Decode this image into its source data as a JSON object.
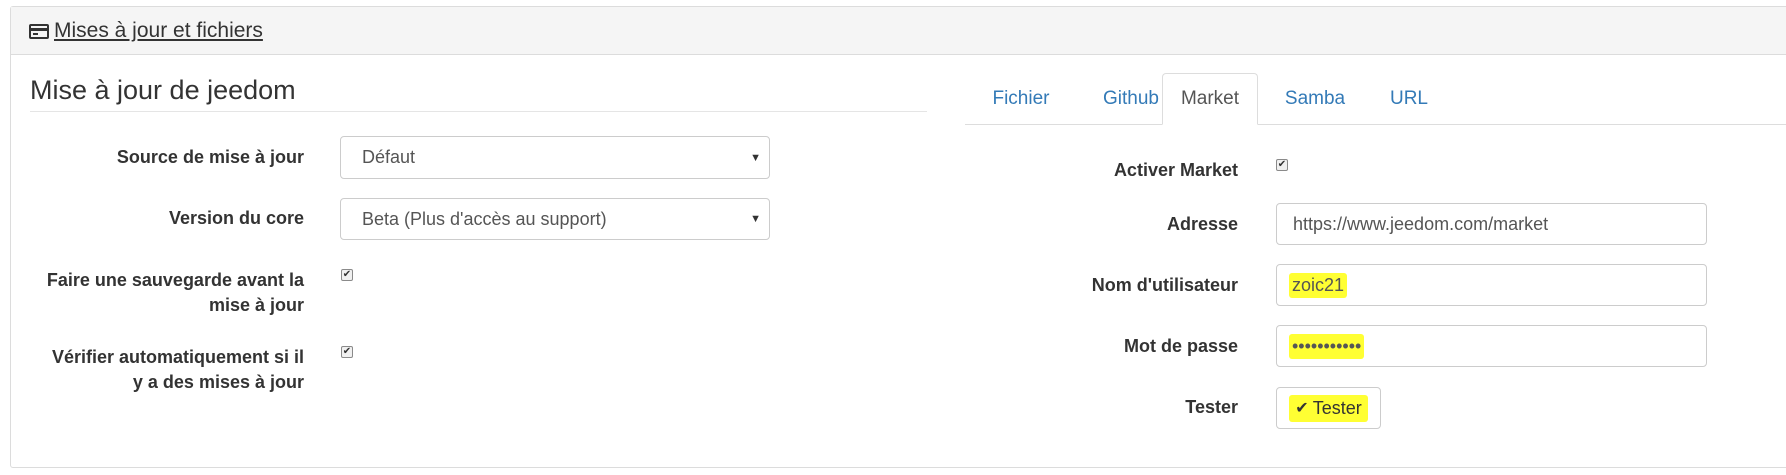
{
  "panel": {
    "title": "Mises à jour et fichiers",
    "icon": "credit-card-icon"
  },
  "update": {
    "title": "Mise à jour de jeedom",
    "source_label": "Source de mise à jour",
    "source_value": "Défaut",
    "version_label": "Version du core",
    "version_value": "Beta (Plus d'accès au support)",
    "backup_label_line1": "Faire une sauvegarde avant la",
    "backup_label_line2": "mise à jour",
    "backup_checked": true,
    "autocheck_label_line1": "Vérifier automatiquement si il",
    "autocheck_label_line2": "y a des mises à jour",
    "autocheck_checked": true
  },
  "tabs": [
    {
      "label": "Fichier",
      "active": false
    },
    {
      "label": "Github",
      "active": false
    },
    {
      "label": "Market",
      "active": true
    },
    {
      "label": "Samba",
      "active": false
    },
    {
      "label": "URL",
      "active": false
    }
  ],
  "market": {
    "enable_label": "Activer Market",
    "enable_checked": true,
    "address_label": "Adresse",
    "address_value": "https://www.jeedom.com/market",
    "username_label": "Nom d'utilisateur",
    "username_value": "zoic21",
    "password_label": "Mot de passe",
    "password_value": "•••••••••••",
    "test_label": "Tester",
    "test_button": "Tester",
    "highlight_color": "#ffff33"
  },
  "colors": {
    "link": "#337ab7",
    "border": "#cccccc",
    "heading_bg": "#f5f5f5"
  }
}
